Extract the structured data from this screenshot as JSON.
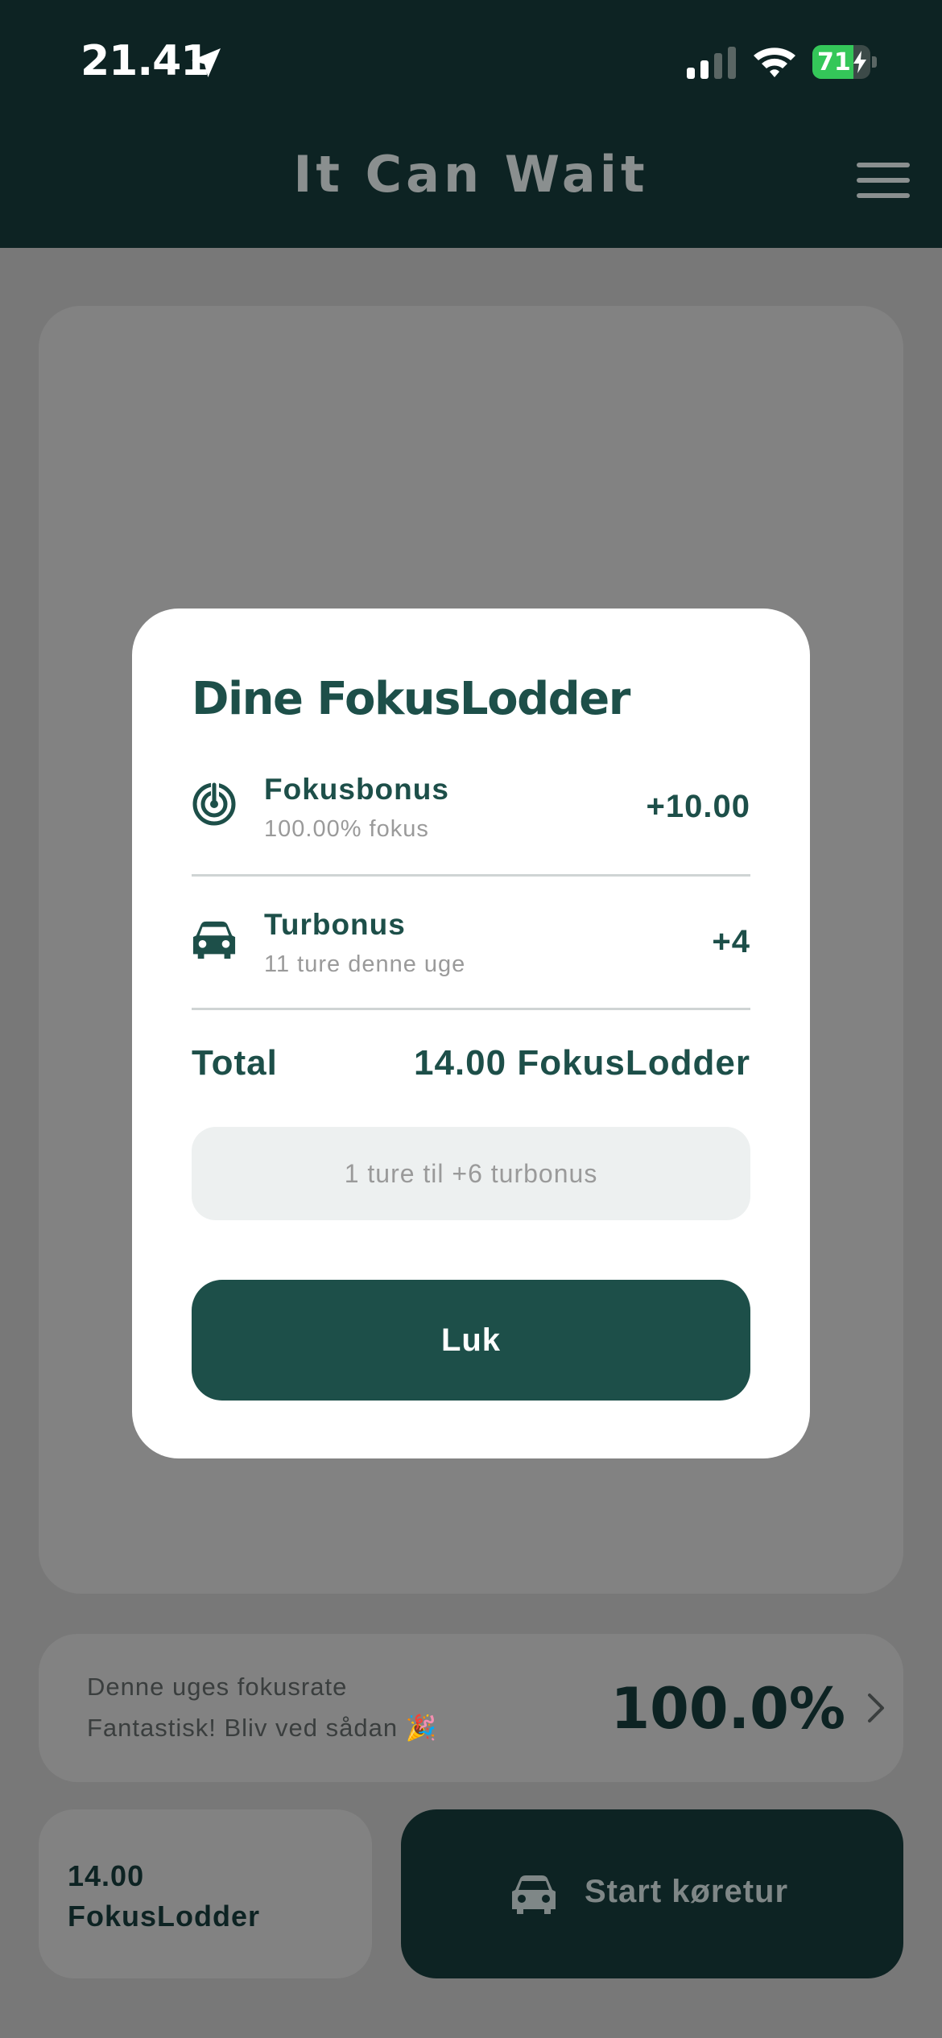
{
  "status_bar": {
    "time": "21.41",
    "battery_level": "71",
    "battery_fraction": 0.71,
    "icons": [
      "location-arrow-icon",
      "cellular-signal-icon",
      "wifi-icon",
      "battery-icon",
      "charging-bolt-icon"
    ]
  },
  "header": {
    "title": "It Can Wait",
    "menu_icon": "hamburger-menu-icon"
  },
  "modal": {
    "title": "Dine FokusLodder",
    "rows": [
      {
        "icon": "focus-target-icon",
        "label": "Fokusbonus",
        "sub": "100.00% fokus",
        "value": "+10.00"
      },
      {
        "icon": "car-icon",
        "label": "Turbonus",
        "sub": "11 ture denne uge",
        "value": "+4"
      }
    ],
    "total_label": "Total",
    "total_value": "14.00 FokusLodder",
    "hint": "1 ture til +6 turbonus",
    "close_label": "Luk"
  },
  "weekly_rate": {
    "label": "Denne uges fokusrate",
    "sub": "Fantastisk! Bliv ved sådan 🎉",
    "value": "100.0%",
    "chevron_icon": "chevron-right-icon"
  },
  "lodder_summary": {
    "amount": "14.00",
    "unit": "FokusLodder"
  },
  "start_trip": {
    "label": "Start køretur",
    "icon": "car-icon"
  },
  "colors": {
    "header_bg": "#0d2323",
    "brand_dark": "#1d4f49",
    "overlay_bg": "#787878",
    "battery_green": "#34c759"
  }
}
